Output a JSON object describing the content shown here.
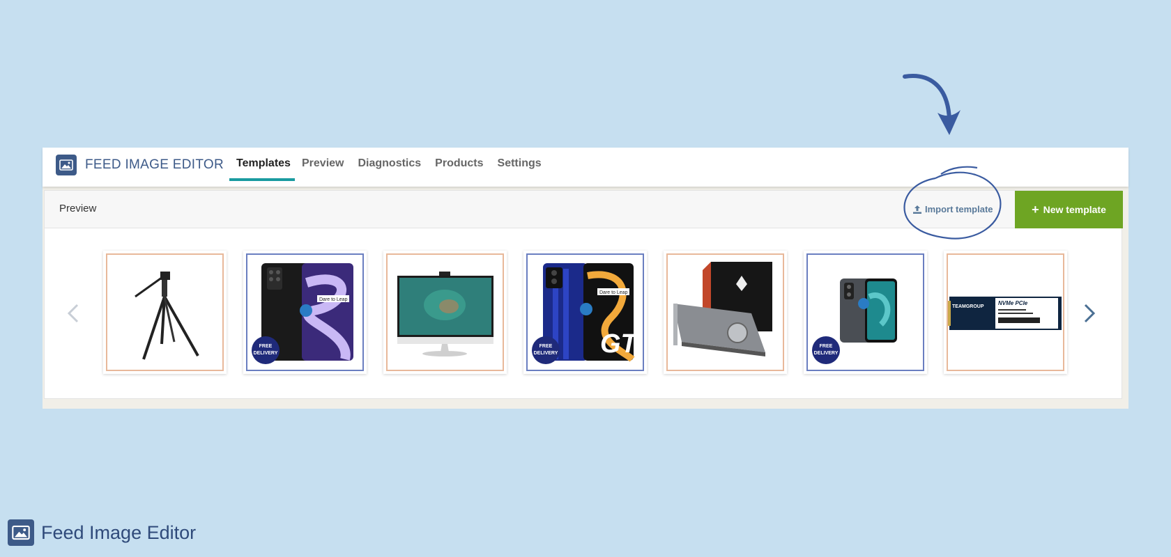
{
  "app": {
    "title": "FEED IMAGE EDITOR",
    "logo_icon": "image-icon"
  },
  "tabs": [
    {
      "label": "Templates",
      "active": true
    },
    {
      "label": "Preview",
      "active": false
    },
    {
      "label": "Diagnostics",
      "active": false
    },
    {
      "label": "Products",
      "active": false
    },
    {
      "label": "Settings",
      "active": false
    }
  ],
  "panel": {
    "title": "Preview",
    "import_label": "Import template",
    "import_icon": "upload-icon",
    "new_label": "New template",
    "new_icon": "plus-icon"
  },
  "carousel": {
    "prev_icon": "chevron-left-icon",
    "next_icon": "chevron-right-icon",
    "items": [
      {
        "product": "tripod",
        "frame": "orange",
        "badge": ""
      },
      {
        "product": "smartphone-purple",
        "frame": "blue",
        "badge": "FREE DELIVERY",
        "phone_label": "Dare to Leap"
      },
      {
        "product": "all-in-one-monitor",
        "frame": "orange",
        "badge": ""
      },
      {
        "product": "smartphone-gt",
        "frame": "blue",
        "badge": "FREE DELIVERY",
        "phone_label": "Dare to Leap"
      },
      {
        "product": "graphics-card",
        "frame": "orange",
        "badge": ""
      },
      {
        "product": "smartphone-gray",
        "frame": "blue",
        "badge": "FREE DELIVERY"
      },
      {
        "product": "nvme-ssd",
        "frame": "orange",
        "badge": "",
        "ssd_brand": "TEAMGROUP",
        "ssd_label": "NVMe PCIe"
      }
    ]
  },
  "colors": {
    "accent": "#1a9ba0",
    "primary_button": "#6ea523",
    "brand": "#3d5a88",
    "badge": "#1f2a7a"
  },
  "footer": {
    "title": "Feed Image Editor"
  }
}
